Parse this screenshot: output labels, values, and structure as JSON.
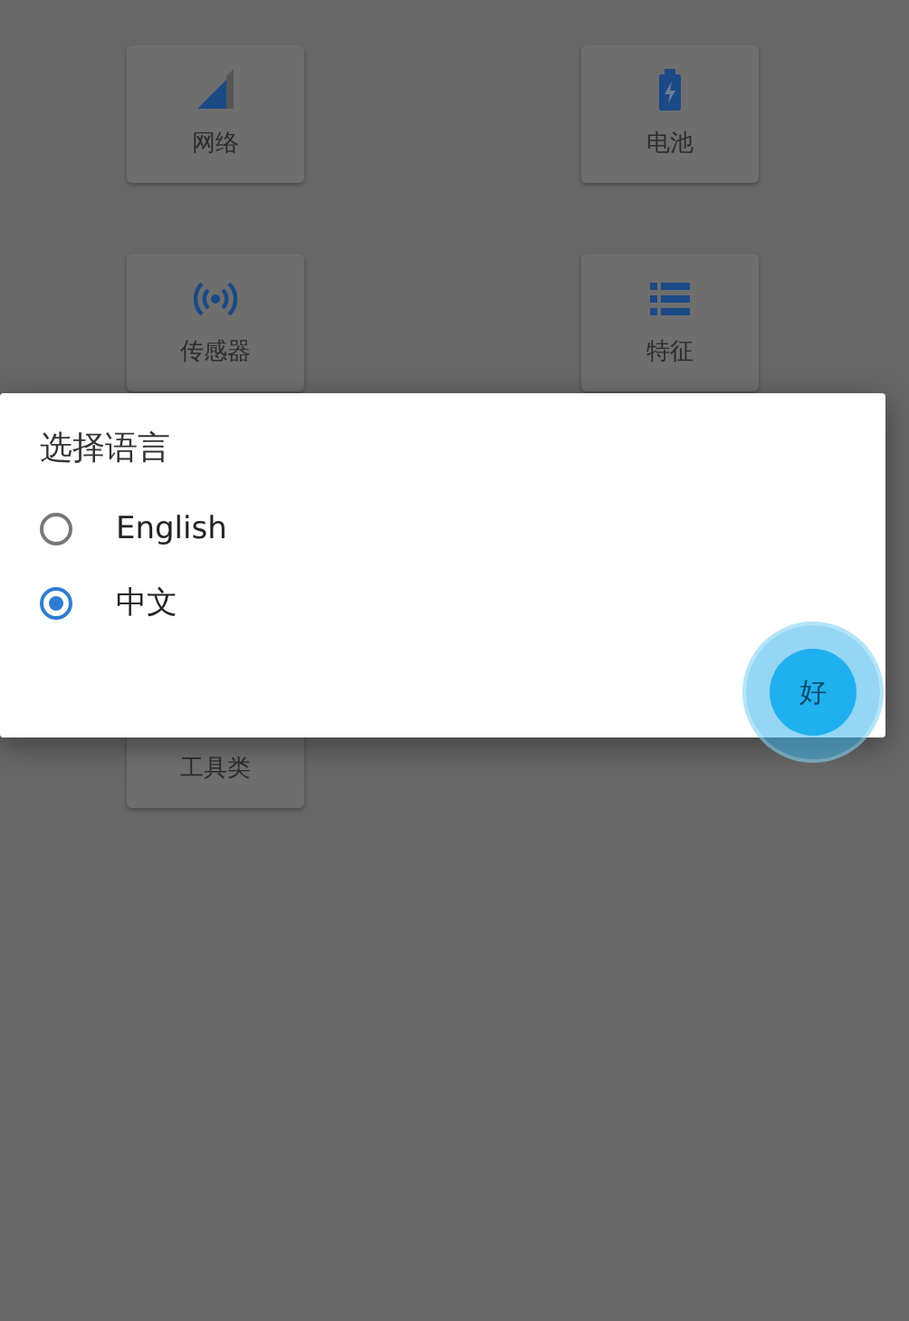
{
  "cards": [
    {
      "label": "网络",
      "kind": "signal"
    },
    {
      "label": "电池",
      "kind": "battery"
    },
    {
      "label": "传感器",
      "kind": "sensor"
    },
    {
      "label": "特征",
      "kind": "list"
    },
    {
      "label": "工具类",
      "kind": "plain"
    }
  ],
  "dialog": {
    "title": "选择语言",
    "options": [
      {
        "label": "English",
        "selected": false
      },
      {
        "label": "中文",
        "selected": true
      }
    ],
    "button": "好"
  }
}
